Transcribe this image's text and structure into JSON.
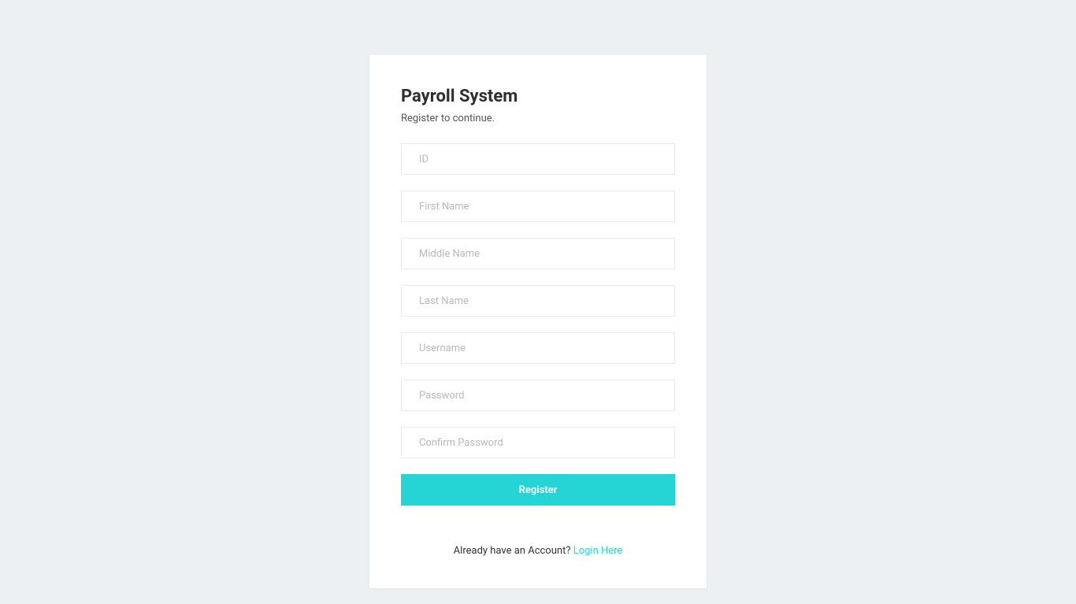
{
  "header": {
    "title": "Payroll System",
    "subtitle": "Register to continue."
  },
  "form": {
    "id_placeholder": "ID",
    "first_name_placeholder": "First Name",
    "middle_name_placeholder": "Middle Name",
    "last_name_placeholder": "Last Name",
    "username_placeholder": "Username",
    "password_placeholder": "Password",
    "confirm_password_placeholder": "Confirm Password",
    "register_button": "Register"
  },
  "footer": {
    "prompt": "Already have an Account? ",
    "link_text": "Login Here"
  }
}
